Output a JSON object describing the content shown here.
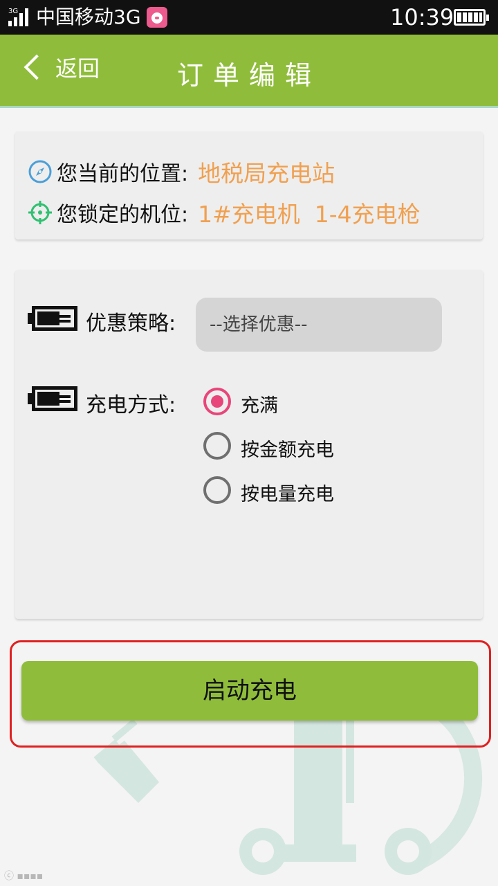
{
  "status_bar": {
    "network_tag": "3G",
    "carrier": "中国移动3G",
    "time": "10:39"
  },
  "header": {
    "back_label": "返回",
    "title": "订单编辑"
  },
  "location_card": {
    "current_location_label": "您当前的位置:",
    "current_location_value": "地税局充电站",
    "locked_station_label": "您锁定的机位:",
    "locked_station_value": "1#充电机  1-4充电枪"
  },
  "options_card": {
    "discount_label": "优惠策略:",
    "discount_placeholder": "--选择优惠--",
    "charge_mode_label": "充电方式:",
    "charge_modes": [
      {
        "label": "充满",
        "selected": true
      },
      {
        "label": "按金额充电",
        "selected": false
      },
      {
        "label": "按电量充电",
        "selected": false
      }
    ]
  },
  "start_button_label": "启动充电",
  "colors": {
    "brand_green": "#8fbd3b",
    "value_orange": "#f0a050",
    "radio_pink": "#e8457a",
    "highlight_red": "#e02020"
  }
}
